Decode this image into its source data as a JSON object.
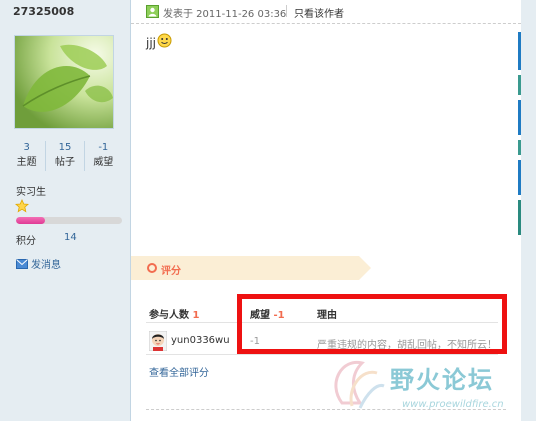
{
  "user": {
    "id": "27325008",
    "stats": [
      {
        "value": "3",
        "label": "主题"
      },
      {
        "value": "15",
        "label": "帖子"
      },
      {
        "value": "-1",
        "label": "威望"
      }
    ],
    "rank": "实习生",
    "score_label": "积分",
    "score_value": "14",
    "send_message": "发消息",
    "level_progress": 0.27
  },
  "post": {
    "posted_at": "发表于 2011-11-26 03:36",
    "only_author": "只看该作者",
    "content": "jjj"
  },
  "rating": {
    "tag": "评分",
    "col_participants": "参与人数",
    "participants_count": "1",
    "col_prestige": "威望",
    "prestige_total": "-1",
    "col_reason": "理由",
    "row": {
      "user": "yun0336wu",
      "value": "-1",
      "reason": "严重违规的内容，胡乱回帖，不知所云！"
    },
    "view_all": "查看全部评分"
  },
  "watermark": {
    "text": "野火论坛",
    "url": "www.proewildfire.cn"
  },
  "colors": {
    "link": "#336699",
    "accent": "#f26c4f",
    "highlight_box": "#ee1111",
    "background": "#e5edf2"
  }
}
